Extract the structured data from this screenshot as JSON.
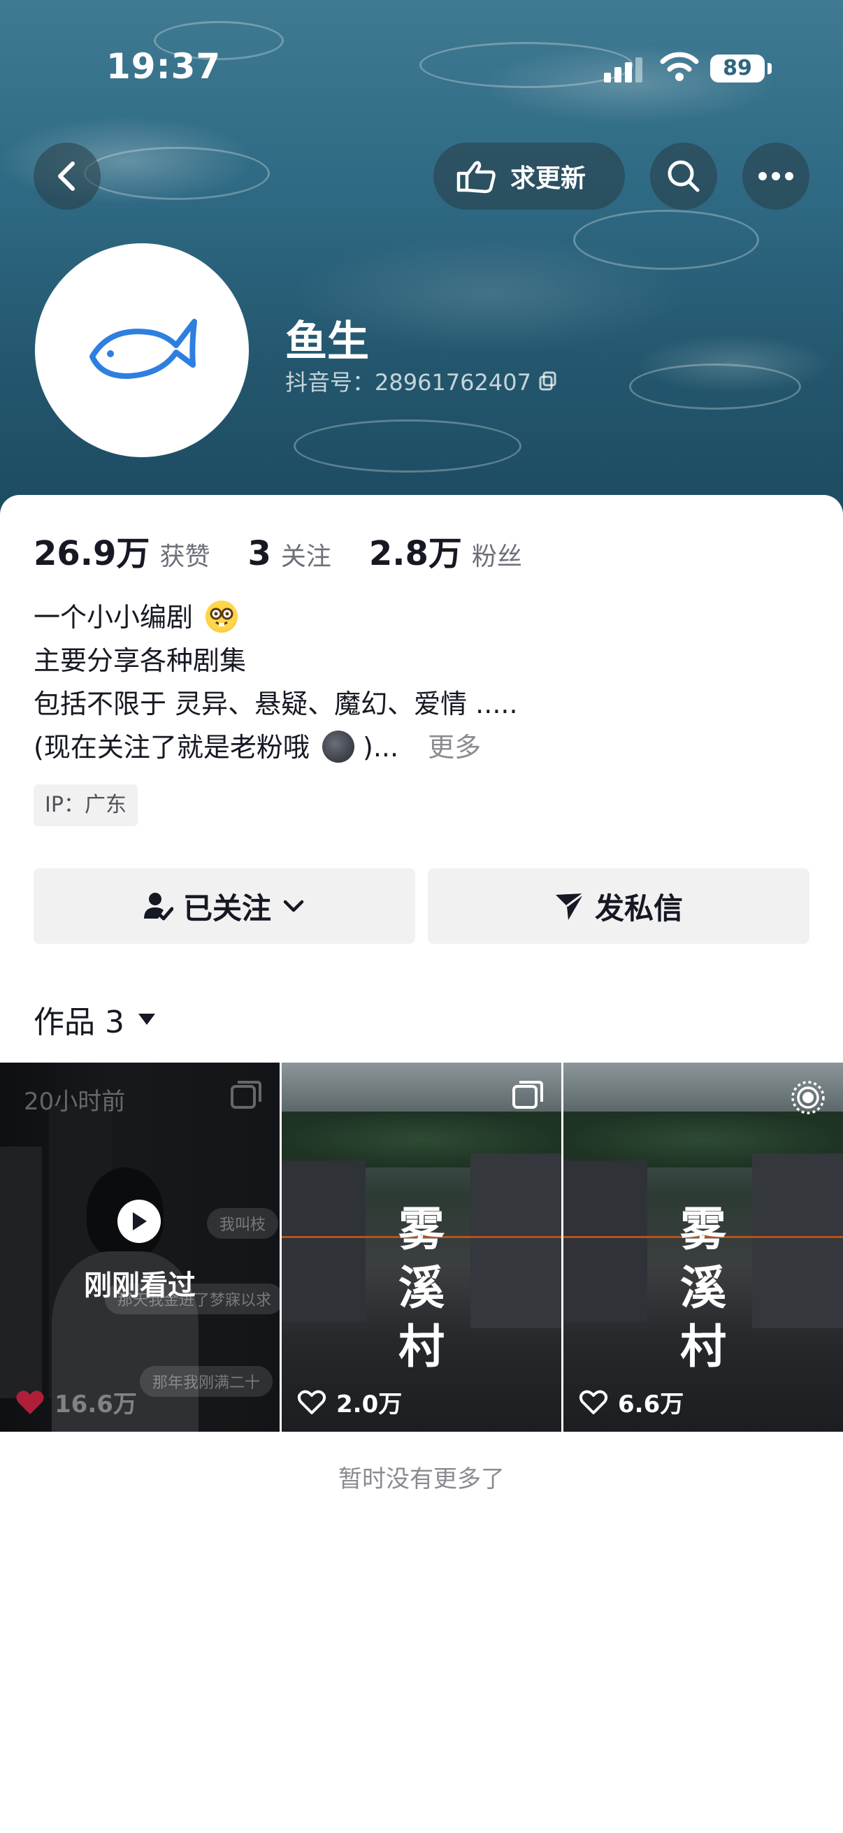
{
  "status_bar": {
    "time": "19:37",
    "battery": "89"
  },
  "header": {
    "update_request_label": "求更新",
    "username": "鱼生",
    "douyin_id": "抖音号：28961762407"
  },
  "stats": {
    "likes_value": "26.9万",
    "likes_label": "获赞",
    "following_value": "3",
    "following_label": "关注",
    "followers_value": "2.8万",
    "followers_label": "粉丝"
  },
  "bio": {
    "line1": "一个小小编剧",
    "line2": "主要分享各种剧集",
    "line3": "包括不限于 灵异、悬疑、魔幻、爱情 .....",
    "line4_start": "(现在关注了就是老粉哦",
    "line4_end": ")...",
    "more": "更多"
  },
  "ip": "IP：广东",
  "actions": {
    "followed_label": "已关注",
    "message_label": "发私信"
  },
  "works": {
    "tab_label": "作品 3",
    "items": [
      {
        "timestamp": "20小时前",
        "seen_label": "刚刚看过",
        "likes": "16.6万",
        "bubble1": "我叫枝",
        "bubble2": "那天我金进了梦寐以求",
        "bubble3": "那年我刚满二十"
      },
      {
        "title": "雾溪村",
        "likes": "2.0万"
      },
      {
        "title": "雾溪村",
        "likes": "6.6万"
      }
    ]
  },
  "footer": {
    "no_more": "暂时没有更多了"
  },
  "colors": {
    "text": "#161823",
    "muted": "#8a8b91",
    "button_bg": "#f1f1f2",
    "like_red": "#fe2c55",
    "header_blue": "#2f6a84"
  }
}
